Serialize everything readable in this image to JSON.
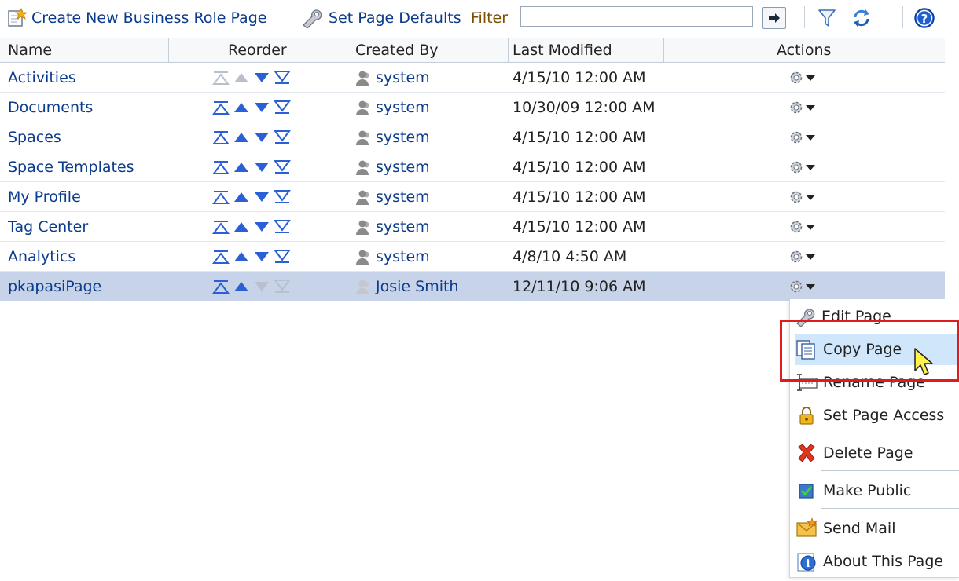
{
  "toolbar": {
    "create_label": "Create New Business Role Page",
    "defaults_label": "Set Page Defaults",
    "filter_label": "Filter",
    "filter_value": "",
    "icons": [
      "create-page-icon",
      "wrench-icon",
      "go-arrow-icon",
      "filter-funnel-icon",
      "refresh-icon",
      "help-icon"
    ]
  },
  "table": {
    "columns": [
      "Name",
      "Reorder",
      "Created By",
      "Last Modified",
      "Actions"
    ],
    "rows": [
      {
        "name": "Activities",
        "created_by": "system",
        "modified": "4/15/10 12:00 AM"
      },
      {
        "name": "Documents",
        "created_by": "system",
        "modified": "10/30/09 12:00 AM"
      },
      {
        "name": "Spaces",
        "created_by": "system",
        "modified": "4/15/10 12:00 AM"
      },
      {
        "name": "Space Templates",
        "created_by": "system",
        "modified": "4/15/10 12:00 AM"
      },
      {
        "name": "My Profile",
        "created_by": "system",
        "modified": "4/15/10 12:00 AM"
      },
      {
        "name": "Tag Center",
        "created_by": "system",
        "modified": "4/15/10 12:00 AM"
      },
      {
        "name": "Analytics",
        "created_by": "system",
        "modified": "4/8/10 4:50 AM"
      },
      {
        "name": "pkapasiPage",
        "created_by": "Josie Smith",
        "modified": "12/11/10 9:06 AM"
      }
    ],
    "selected_row": "pkapasiPage"
  },
  "menu": {
    "items": [
      {
        "label": "Edit Page",
        "icon": "wrench-icon"
      },
      {
        "label": "Copy Page",
        "icon": "copy-icon"
      },
      {
        "label": "Rename Page",
        "icon": "rename-icon"
      },
      {
        "label": "Set Page Access",
        "icon": "lock-icon"
      },
      {
        "label": "Delete Page",
        "icon": "delete-icon"
      },
      {
        "label": "Make Public",
        "icon": "check-icon"
      },
      {
        "label": "Send Mail",
        "icon": "mail-icon"
      },
      {
        "label": "About This Page",
        "icon": "info-icon"
      }
    ],
    "hovered": "Copy Page"
  },
  "colors": {
    "link": "#0b3b8c",
    "selected_row": "#c7d3e8",
    "menu_hover": "#cfe6fb",
    "highlight": "#e01b1b"
  }
}
